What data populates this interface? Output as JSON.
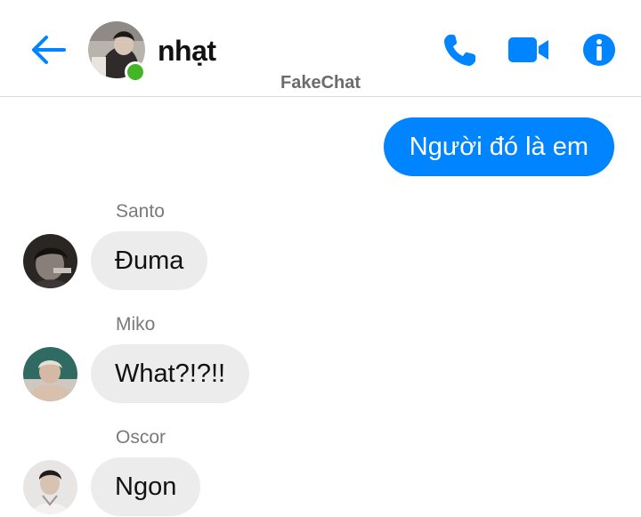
{
  "header": {
    "contact_name": "nhạt",
    "online": true,
    "watermark": "FakeChat",
    "icons": {
      "back": "back-arrow-icon",
      "call": "phone-icon",
      "video": "video-camera-icon",
      "info": "info-icon"
    }
  },
  "colors": {
    "accent": "#0084ff",
    "online": "#44b527",
    "incoming_bubble": "#ececec",
    "sender_text": "#7a7a7a"
  },
  "messages": [
    {
      "direction": "outgoing",
      "text": "Người đó là em"
    },
    {
      "direction": "incoming",
      "sender": "Santo",
      "text": "Đuma"
    },
    {
      "direction": "incoming",
      "sender": "Miko",
      "text": "What?!?!!"
    },
    {
      "direction": "incoming",
      "sender": "Oscor",
      "text": "Ngon"
    }
  ]
}
